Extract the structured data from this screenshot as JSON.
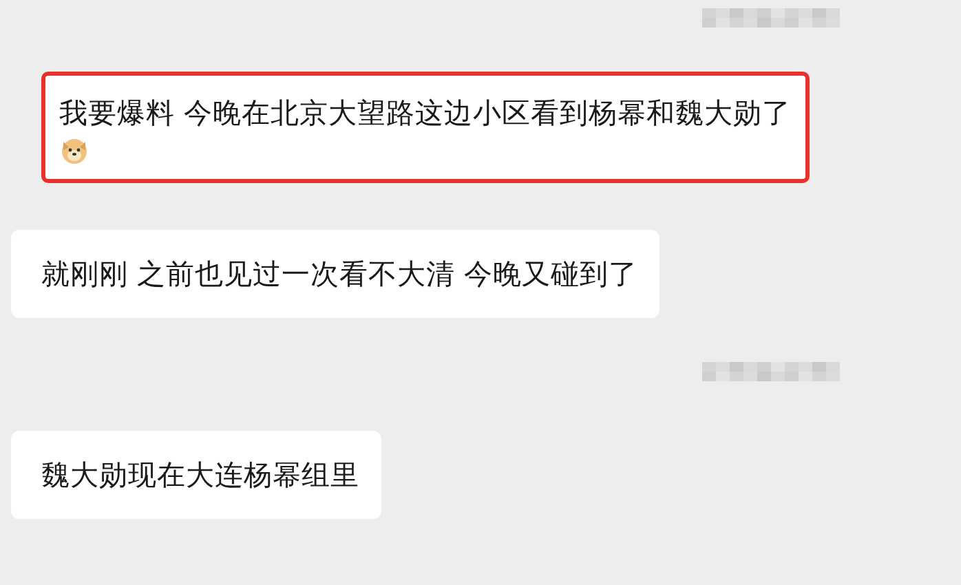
{
  "messages": [
    {
      "kind": "timestamp"
    },
    {
      "kind": "bubble",
      "text": "我要爆料 今晚在北京大望路这边小区看到杨幂和魏大勋了",
      "emoji": true,
      "highlighted": true
    },
    {
      "kind": "bubble",
      "text": "就刚刚 之前也见过一次看不大清 今晚又碰到了",
      "emoji": false,
      "highlighted": false
    },
    {
      "kind": "timestamp"
    },
    {
      "kind": "bubble",
      "text": "魏大勋现在大连杨幂组里",
      "emoji": false,
      "highlighted": false
    }
  ]
}
